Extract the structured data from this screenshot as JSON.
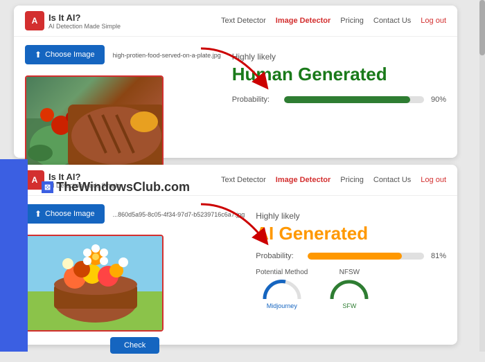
{
  "app": {
    "logo_letter": "A",
    "logo_title": "Is It AI?",
    "logo_subtitle": "AI Detection Made Simple"
  },
  "nav": {
    "text_detector": "Text Detector",
    "image_detector": "Image Detector",
    "pricing": "Pricing",
    "contact_us": "Contact Us",
    "logout": "Log out"
  },
  "card1": {
    "choose_btn": "Choose Image",
    "file_name": "high-protien-food-served-on-a-plate.jpg",
    "highly_likely": "Highly likely",
    "result": "Human Generated",
    "probability_label": "Probability:",
    "probability_pct": "90%",
    "progress_width": "90"
  },
  "card2": {
    "choose_btn": "Choose Image",
    "file_name": "...860d5a95-8c05-4f34-97d7-b5239716c6a7.jpg",
    "highly_likely": "Highly likely",
    "result": "AI Generated",
    "probability_label": "Probability:",
    "probability_pct": "81%",
    "progress_width": "81",
    "check_btn": "Check",
    "potential_method": "Potential Method",
    "nsfw": "NFSW",
    "gauge1_name": "Midjourney",
    "gauge2_name": "SFW"
  },
  "watermark": {
    "box_text": "⊠",
    "text": "TheWindowsClub.com"
  }
}
